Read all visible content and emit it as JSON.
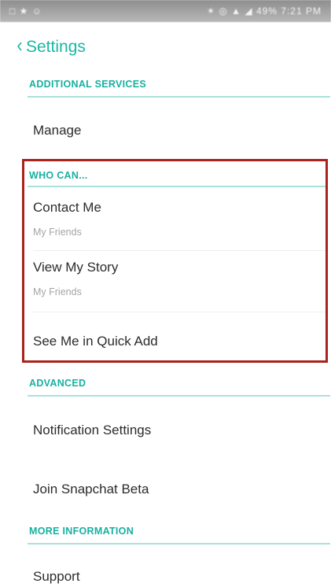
{
  "status_bar": {
    "left_glyphs": "□ ★ ☺",
    "right_glyphs": "✶ ◎ ▲ ◢ 49% 7:21 PM"
  },
  "header": {
    "back_icon": "chevron-left-icon",
    "title": "Settings"
  },
  "sections": {
    "additional_services": {
      "label": "ADDITIONAL SERVICES",
      "items": {
        "manage": "Manage"
      }
    },
    "who_can": {
      "label": "WHO CAN...",
      "items": {
        "contact_me": {
          "label": "Contact Me",
          "value": "My Friends"
        },
        "view_my_story": {
          "label": "View My Story",
          "value": "My Friends"
        },
        "see_me_in_quick_add": {
          "label": "See Me in Quick Add"
        }
      }
    },
    "advanced": {
      "label": "ADVANCED",
      "items": {
        "notification_settings": "Notification Settings",
        "join_beta": "Join Snapchat Beta"
      }
    },
    "more_information": {
      "label": "MORE INFORMATION",
      "items": {
        "support": "Support"
      }
    }
  },
  "colors": {
    "accent": "#1ab7a5",
    "section_line": "#a8e2dc",
    "highlight": "#a8231b"
  }
}
